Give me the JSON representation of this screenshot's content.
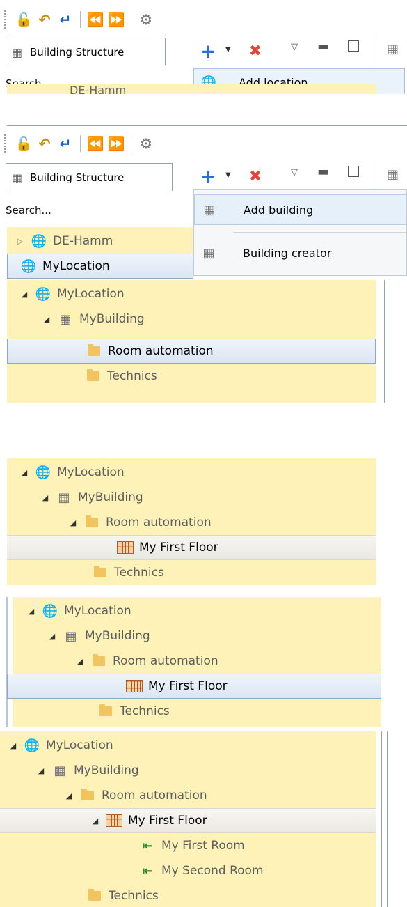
{
  "toolbar": {
    "icons": [
      "lock-icon",
      "undo-icon",
      "undo-alt-icon",
      "back-circle-icon",
      "forward-circle-icon",
      "settings-gears-icon"
    ]
  },
  "panel1": {
    "tab_label": "Building Structure",
    "search_placeholder": "Search...",
    "menu_items": [
      "Add location"
    ],
    "partial_tree_item": "DE-Hamm"
  },
  "panel2": {
    "tab_label": "Building Structure",
    "search_placeholder": "Search...",
    "menu_items": [
      "Add building",
      "Building creator"
    ],
    "tree": [
      "DE-Hamm",
      "MyLocation"
    ]
  },
  "tree_labels": {
    "location": "MyLocation",
    "building": "MyBuilding",
    "room_automation": "Room automation",
    "technics": "Technics",
    "floor": "My First Floor",
    "room1": "My First Room",
    "room2": "My Second Room"
  },
  "colors": {
    "tree_bg": "#fff2b8",
    "selection_blue": "#dbe6f3",
    "add_icon": "#2b6ed6",
    "delete_icon": "#e0453a",
    "toolbar_icon": "#c98a12"
  }
}
